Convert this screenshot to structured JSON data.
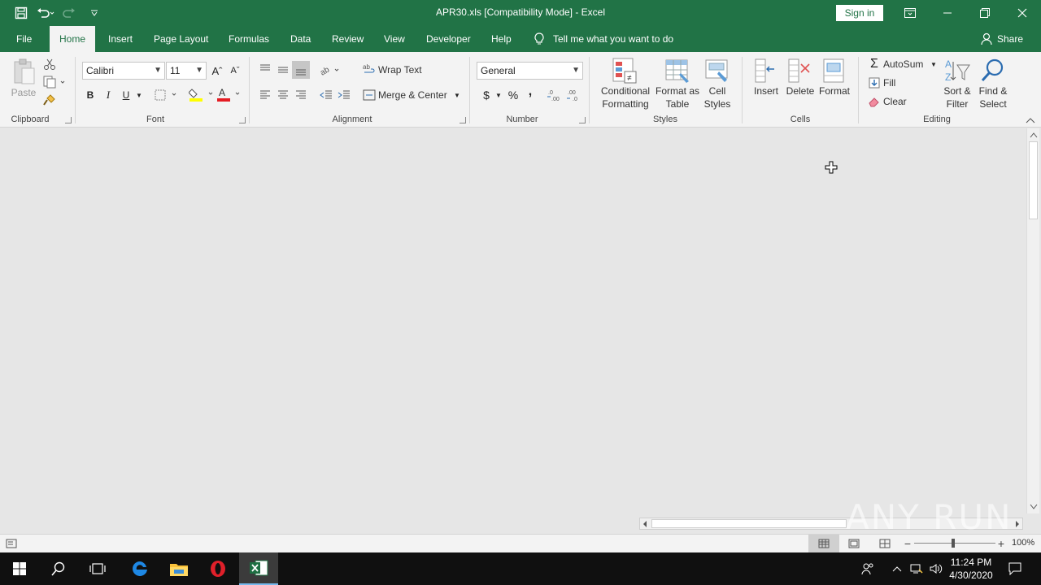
{
  "window": {
    "title": "APR30.xls  [Compatibility Mode]  -  Excel",
    "sign_in": "Sign in"
  },
  "tabs": {
    "file": "File",
    "home": "Home",
    "insert": "Insert",
    "page_layout": "Page Layout",
    "formulas": "Formulas",
    "data": "Data",
    "review": "Review",
    "view": "View",
    "developer": "Developer",
    "help": "Help",
    "tell_me": "Tell me what you want to do",
    "share": "Share"
  },
  "ribbon": {
    "clipboard": {
      "label": "Clipboard",
      "paste": "Paste"
    },
    "font": {
      "label": "Font",
      "font_name": "Calibri",
      "font_size": "11",
      "bold": "B",
      "italic": "I",
      "underline": "U"
    },
    "alignment": {
      "label": "Alignment",
      "wrap_text": "Wrap Text",
      "merge_center": "Merge & Center"
    },
    "number": {
      "label": "Number",
      "format": "General",
      "currency": "$",
      "percent": "%",
      "comma": ","
    },
    "styles": {
      "label": "Styles",
      "conditional_1": "Conditional",
      "conditional_2": "Formatting",
      "format_table_1": "Format as",
      "format_table_2": "Table",
      "cell_styles_1": "Cell",
      "cell_styles_2": "Styles"
    },
    "cells": {
      "label": "Cells",
      "insert": "Insert",
      "delete": "Delete",
      "format": "Format"
    },
    "editing": {
      "label": "Editing",
      "autosum": "AutoSum",
      "fill": "Fill",
      "clear": "Clear",
      "sort_1": "Sort &",
      "sort_2": "Filter",
      "find_1": "Find &",
      "find_2": "Select"
    }
  },
  "statusbar": {
    "zoom": "100%"
  },
  "taskbar": {
    "time": "11:24 PM",
    "date": "4/30/2020"
  },
  "watermark": "ANY RUN",
  "colors": {
    "excel_green": "#217346",
    "ribbon_bg": "#f3f3f3",
    "sheet_bg": "#e6e6e6",
    "taskbar_bg": "#101010"
  }
}
